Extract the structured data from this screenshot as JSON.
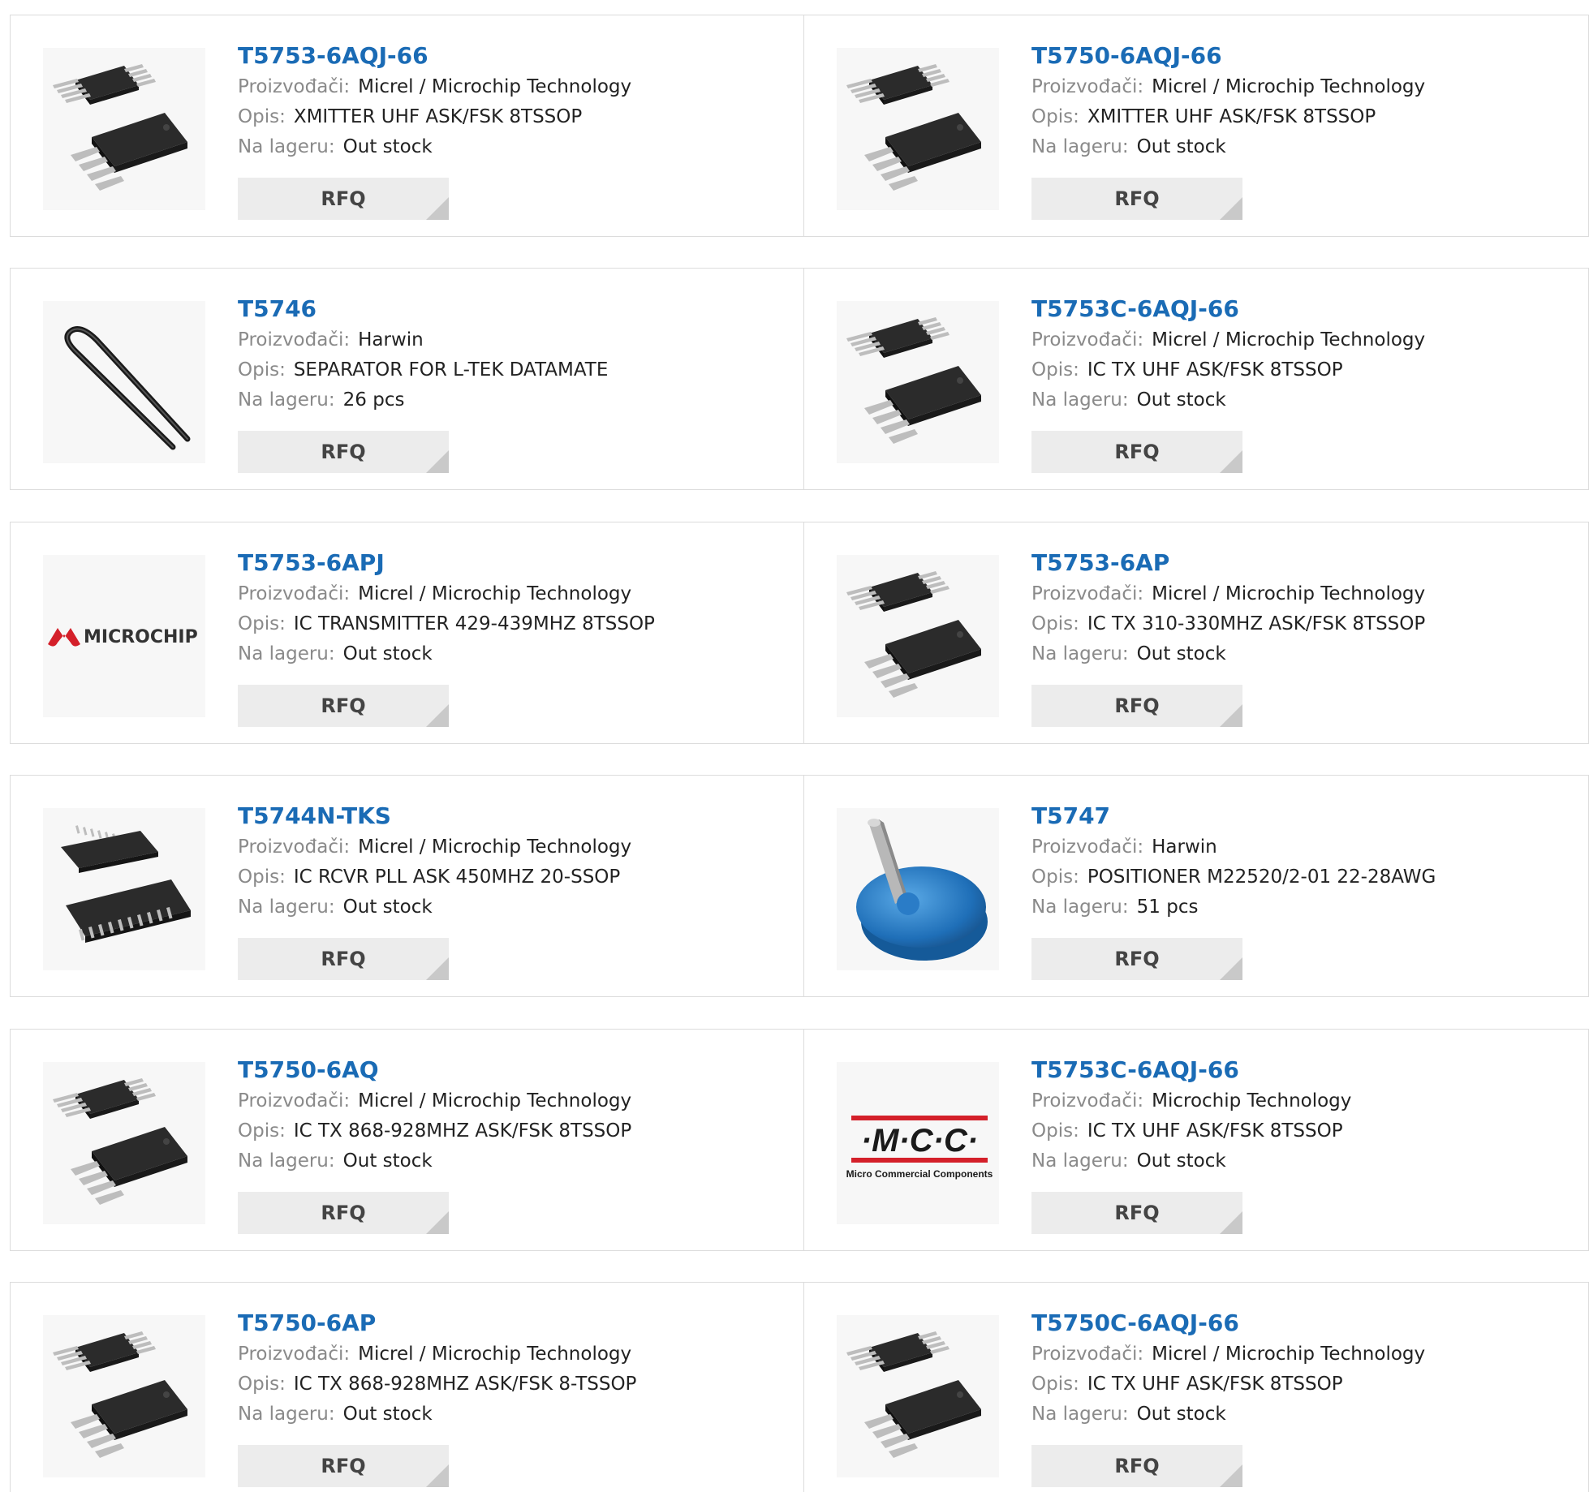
{
  "labels": {
    "manufacturer": "Proizvođači:",
    "description": "Opis:",
    "stock": "Na lageru:",
    "rfq": "RFQ"
  },
  "colors": {
    "title_link": "#1a6bb5",
    "label_gray": "#8a8a8a",
    "rfq_bg": "#ececec"
  },
  "products": [
    {
      "part": "T5753-6AQJ-66",
      "manufacturer": "Micrel / Microchip Technology",
      "description": "XMITTER UHF ASK/FSK 8TSSOP",
      "stock": "Out stock",
      "image": "tssop-chip-icon"
    },
    {
      "part": "T5750-6AQJ-66",
      "manufacturer": "Micrel / Microchip Technology",
      "description": "XMITTER UHF ASK/FSK 8TSSOP",
      "stock": "Out stock",
      "image": "tssop-chip-icon"
    },
    {
      "part": "T5746",
      "manufacturer": "Harwin",
      "description": "SEPARATOR FOR L-TEK DATAMATE",
      "stock": "26 pcs",
      "image": "separator-tool-icon"
    },
    {
      "part": "T5753C-6AQJ-66",
      "manufacturer": "Micrel / Microchip Technology",
      "description": "IC TX UHF ASK/FSK 8TSSOP",
      "stock": "Out stock",
      "image": "tssop-chip-icon"
    },
    {
      "part": "T5753-6APJ",
      "manufacturer": "Micrel / Microchip Technology",
      "description": "IC TRANSMITTER 429-439MHZ 8TSSOP",
      "stock": "Out stock",
      "image": "microchip-logo",
      "logo_text": "MICROCHIP"
    },
    {
      "part": "T5753-6AP",
      "manufacturer": "Micrel / Microchip Technology",
      "description": "IC TX 310-330MHZ ASK/FSK 8TSSOP",
      "stock": "Out stock",
      "image": "tssop-chip-icon"
    },
    {
      "part": "T5744N-TKS",
      "manufacturer": "Micrel / Microchip Technology",
      "description": "IC RCVR PLL ASK 450MHZ 20-SSOP",
      "stock": "Out stock",
      "image": "ssop20-chip-icon"
    },
    {
      "part": "T5747",
      "manufacturer": "Harwin",
      "description": "POSITIONER M22520/2-01 22-28AWG",
      "stock": "51 pcs",
      "image": "positioner-tool-icon"
    },
    {
      "part": "T5750-6AQ",
      "manufacturer": "Micrel / Microchip Technology",
      "description": "IC TX 868-928MHZ ASK/FSK 8TSSOP",
      "stock": "Out stock",
      "image": "tssop-chip-icon"
    },
    {
      "part": "T5753C-6AQJ-66",
      "manufacturer": "Microchip Technology",
      "description": "IC TX UHF ASK/FSK 8TSSOP",
      "stock": "Out stock",
      "image": "mcc-logo",
      "logo_text": "·M·C·C·",
      "logo_sub": "Micro Commercial Components"
    },
    {
      "part": "T5750-6AP",
      "manufacturer": "Micrel / Microchip Technology",
      "description": "IC TX 868-928MHZ ASK/FSK 8-TSSOP",
      "stock": "Out stock",
      "image": "tssop-chip-icon"
    },
    {
      "part": "T5750C-6AQJ-66",
      "manufacturer": "Micrel / Microchip Technology",
      "description": "IC TX UHF ASK/FSK 8TSSOP",
      "stock": "Out stock",
      "image": "tssop-chip-icon"
    }
  ]
}
